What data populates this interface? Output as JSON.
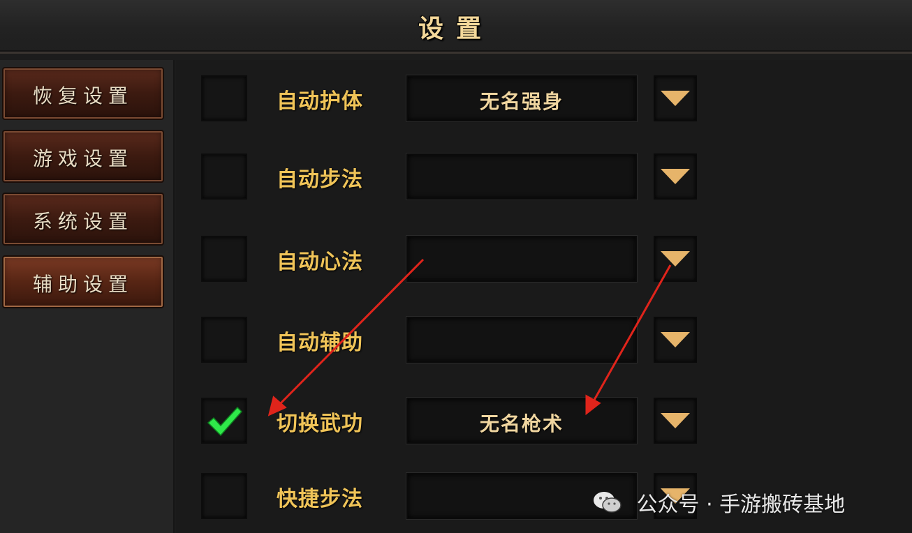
{
  "window": {
    "title": "设置"
  },
  "sidebar": {
    "items": [
      {
        "label": "恢复设置",
        "active": false
      },
      {
        "label": "游戏设置",
        "active": false
      },
      {
        "label": "系统设置",
        "active": false
      },
      {
        "label": "辅助设置",
        "active": true
      }
    ]
  },
  "rows": [
    {
      "label": "自动护体",
      "checked": false,
      "value": "无名强身"
    },
    {
      "label": "自动步法",
      "checked": false,
      "value": ""
    },
    {
      "label": "自动心法",
      "checked": false,
      "value": ""
    },
    {
      "label": "自动辅助",
      "checked": false,
      "value": ""
    },
    {
      "label": "切换武功",
      "checked": true,
      "value": "无名枪术"
    },
    {
      "label": "快捷步法",
      "checked": false,
      "value": ""
    }
  ],
  "icons": {
    "dropdown": "triangle-down-icon",
    "check": "checkmark-icon",
    "watermark": "wechat-icon"
  },
  "colors": {
    "label": "#f0c458",
    "check": "#2fe84a",
    "arrow": "#e0241b",
    "triangle": "#e6b46a"
  },
  "watermark": {
    "text": "公众号 · 手游搬砖基地"
  }
}
